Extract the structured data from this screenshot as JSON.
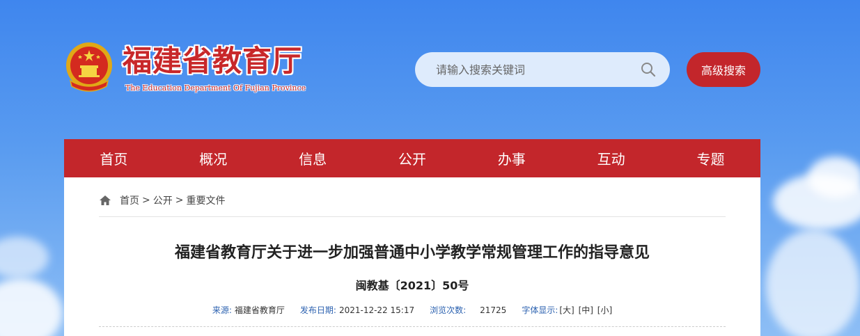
{
  "header": {
    "site_title": "福建省教育厅",
    "site_subtitle": "The Education Department Of Fujian Province",
    "emblem_icon": "national-emblem-icon",
    "search": {
      "placeholder": "请输入搜索关键词",
      "value": ""
    },
    "advanced_search_label": "高级搜索"
  },
  "nav": {
    "items": [
      {
        "label": "首页"
      },
      {
        "label": "概况"
      },
      {
        "label": "信息"
      },
      {
        "label": "公开"
      },
      {
        "label": "办事"
      },
      {
        "label": "互动"
      },
      {
        "label": "专题"
      }
    ]
  },
  "breadcrumb": {
    "icon": "home-icon",
    "items": [
      "首页",
      "公开",
      "重要文件"
    ],
    "separator": ">"
  },
  "article": {
    "title": "福建省教育厅关于进一步加强普通中小学教学常规管理工作的指导意见",
    "doc_number": "闽教基〔2021〕50号",
    "meta": {
      "source_label": "来源:",
      "source_value": "福建省教育厅",
      "date_label": "发布日期:",
      "date_value": "2021-12-22 15:17",
      "views_label": "浏览次数:",
      "views_value": "21725",
      "font_label": "字体显示:",
      "font_large": "[大]",
      "font_medium": "[中]",
      "font_small": "[小]"
    }
  },
  "colors": {
    "brand_red": "#c3262b",
    "meta_blue": "#2c62b0",
    "sky_blue": "#3f86ee"
  }
}
